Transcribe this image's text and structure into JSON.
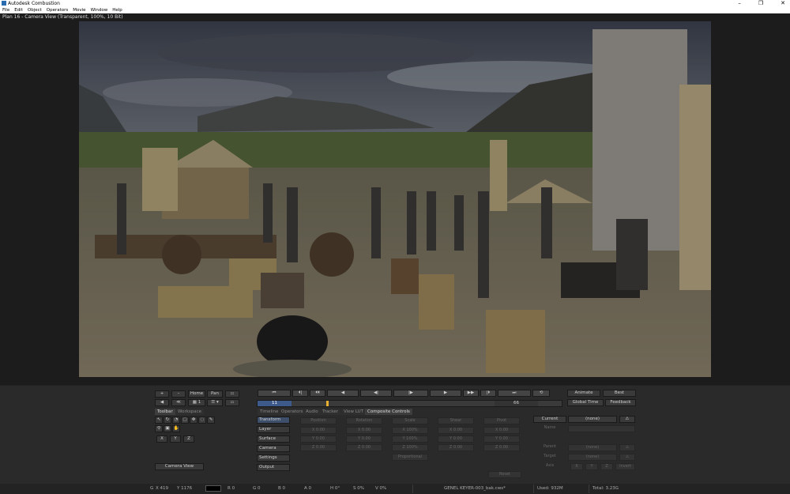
{
  "app": {
    "title": "Autodesk Combustion"
  },
  "menu": [
    "File",
    "Edit",
    "Object",
    "Operators",
    "Movie",
    "Window",
    "Help"
  ],
  "window_controls": [
    "–",
    "❐",
    "✕"
  ],
  "viewer": {
    "title": "Plan 16 - Camera View (Transparent, 100%, 10 Bit)"
  },
  "left_tools": {
    "row1": [
      "+",
      "–",
      "Home",
      "Pan",
      "⚏"
    ],
    "row2": [
      "◀",
      "≪",
      "▦ 1",
      "☰ ▾",
      "⚏"
    ],
    "tabs": [
      "Toolbar",
      "Workspace"
    ],
    "xyz": [
      "X",
      "Y",
      "Z"
    ],
    "camera_view": "Camera View"
  },
  "transport": {
    "buttons": [
      "⏮",
      "⏴|",
      "⏴⏴",
      "◀",
      "◀|",
      "|▶",
      "▶",
      "▶▶",
      "|⏵",
      "⏭",
      "⟲"
    ],
    "current_frame": "11",
    "end_frame": "66"
  },
  "right_top": {
    "animate": "Animate",
    "best": "Best",
    "global_time": "Global Time",
    "feedback": "Feedback"
  },
  "tabs": [
    "Timeline",
    "Operators",
    "Audio",
    "Tracker",
    "View LUT",
    "Composite Controls"
  ],
  "composite": {
    "categories": [
      "Transform",
      "Layer",
      "Surface",
      "Camera",
      "Settings",
      "Output"
    ],
    "columns": [
      "Position",
      "Rotation",
      "Scale",
      "Shear",
      "Pivot"
    ],
    "x_vals": [
      "X 0.00",
      "X 0.00",
      "X 100%",
      "X 0.00",
      "X 0.00"
    ],
    "y_vals": [
      "Y 0.00",
      "Y 0.00",
      "Y 100%",
      "Y 0.00",
      "Y 0.00"
    ],
    "z_vals": [
      "Z 0.00",
      "Z 0.00",
      "Z 100%",
      "Z 0.00",
      "Z 0.00"
    ],
    "proportional": "Proportional",
    "reset": "Reset"
  },
  "right_panel": {
    "current": "Current",
    "none": "(none)",
    "name": "Name",
    "parent": "Parent",
    "target": "Target",
    "parent_val": "(none)",
    "target_val": "(none)",
    "axis": "Axis",
    "axis_btns": [
      "X",
      "Y",
      "Z",
      "Invert"
    ]
  },
  "status": {
    "g_label": "G",
    "x": "X 419",
    "y": "Y 1176",
    "r": "R 0",
    "g": "G 0",
    "b": "B 0",
    "a": "A 0",
    "h": "H 0°",
    "s": "S 0%",
    "v": "V 0%",
    "file": "GENEL KEYER-003_bak.cws*",
    "used": "Used: 932M",
    "total": "Total: 3.23G"
  }
}
